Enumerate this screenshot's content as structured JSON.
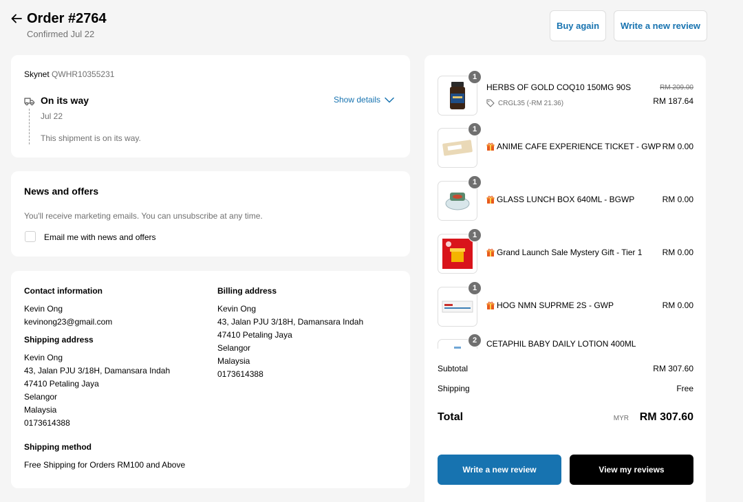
{
  "header": {
    "title": "Order #2764",
    "confirmed": "Confirmed Jul 22",
    "buy_again": "Buy again",
    "write_review": "Write a new review"
  },
  "shipment": {
    "carrier": "Skynet",
    "tracking": "QWHR10355231",
    "status": "On its way",
    "date": "Jul 22",
    "message": "This shipment is on its way.",
    "show_details": "Show details"
  },
  "news": {
    "title": "News and offers",
    "description": "You'll receive marketing emails. You can unsubscribe at any time.",
    "checkbox_label": "Email me with news and offers",
    "checked": false
  },
  "contact": {
    "heading": "Contact information",
    "name": "Kevin Ong",
    "email": "kevinong23@gmail.com"
  },
  "shipping_address": {
    "heading": "Shipping address",
    "lines": [
      "Kevin Ong",
      "43, Jalan PJU 3/18H, Damansara Indah",
      "47410 Petaling Jaya",
      "Selangor",
      "Malaysia",
      "0173614388"
    ]
  },
  "shipping_method": {
    "heading": "Shipping method",
    "value": "Free Shipping for Orders RM100 and Above"
  },
  "billing_address": {
    "heading": "Billing address",
    "lines": [
      "Kevin Ong",
      "43, Jalan PJU 3/18H, Damansara Indah",
      "47410 Petaling Jaya",
      "Selangor",
      "Malaysia",
      "0173614388"
    ]
  },
  "items": [
    {
      "qty": "1",
      "name": "HERBS OF GOLD COQ10 150MG 90S",
      "price": "RM 187.64",
      "old_price": "RM 209.00",
      "discount": "CRGL35 (-RM 21.36)",
      "gift": false
    },
    {
      "qty": "1",
      "name": "ANIME CAFE EXPERIENCE TICKET - GWP",
      "price": "RM 0.00",
      "gift": true
    },
    {
      "qty": "1",
      "name": "GLASS LUNCH BOX 640ML - BGWP",
      "price": "RM 0.00",
      "gift": true
    },
    {
      "qty": "1",
      "name": "Grand Launch Sale Mystery Gift - Tier 1",
      "price": "RM 0.00",
      "gift": true
    },
    {
      "qty": "1",
      "name": "HOG NMN SUPRME 2S - GWP",
      "price": "RM 0.00",
      "gift": true
    },
    {
      "qty": "2",
      "name": "CETAPHIL BABY DAILY LOTION 400ML",
      "price": "",
      "gift": false
    }
  ],
  "summary": {
    "subtotal_label": "Subtotal",
    "subtotal": "RM 307.60",
    "shipping_label": "Shipping",
    "shipping": "Free",
    "total_label": "Total",
    "currency": "MYR",
    "total": "RM 307.60"
  },
  "actions": {
    "write_review": "Write a new review",
    "view_reviews": "View my reviews"
  },
  "colors": {
    "accent": "#1773b0",
    "background": "#f5f5f5",
    "muted_text": "#707070",
    "gift_icon": "#e85a1e"
  }
}
